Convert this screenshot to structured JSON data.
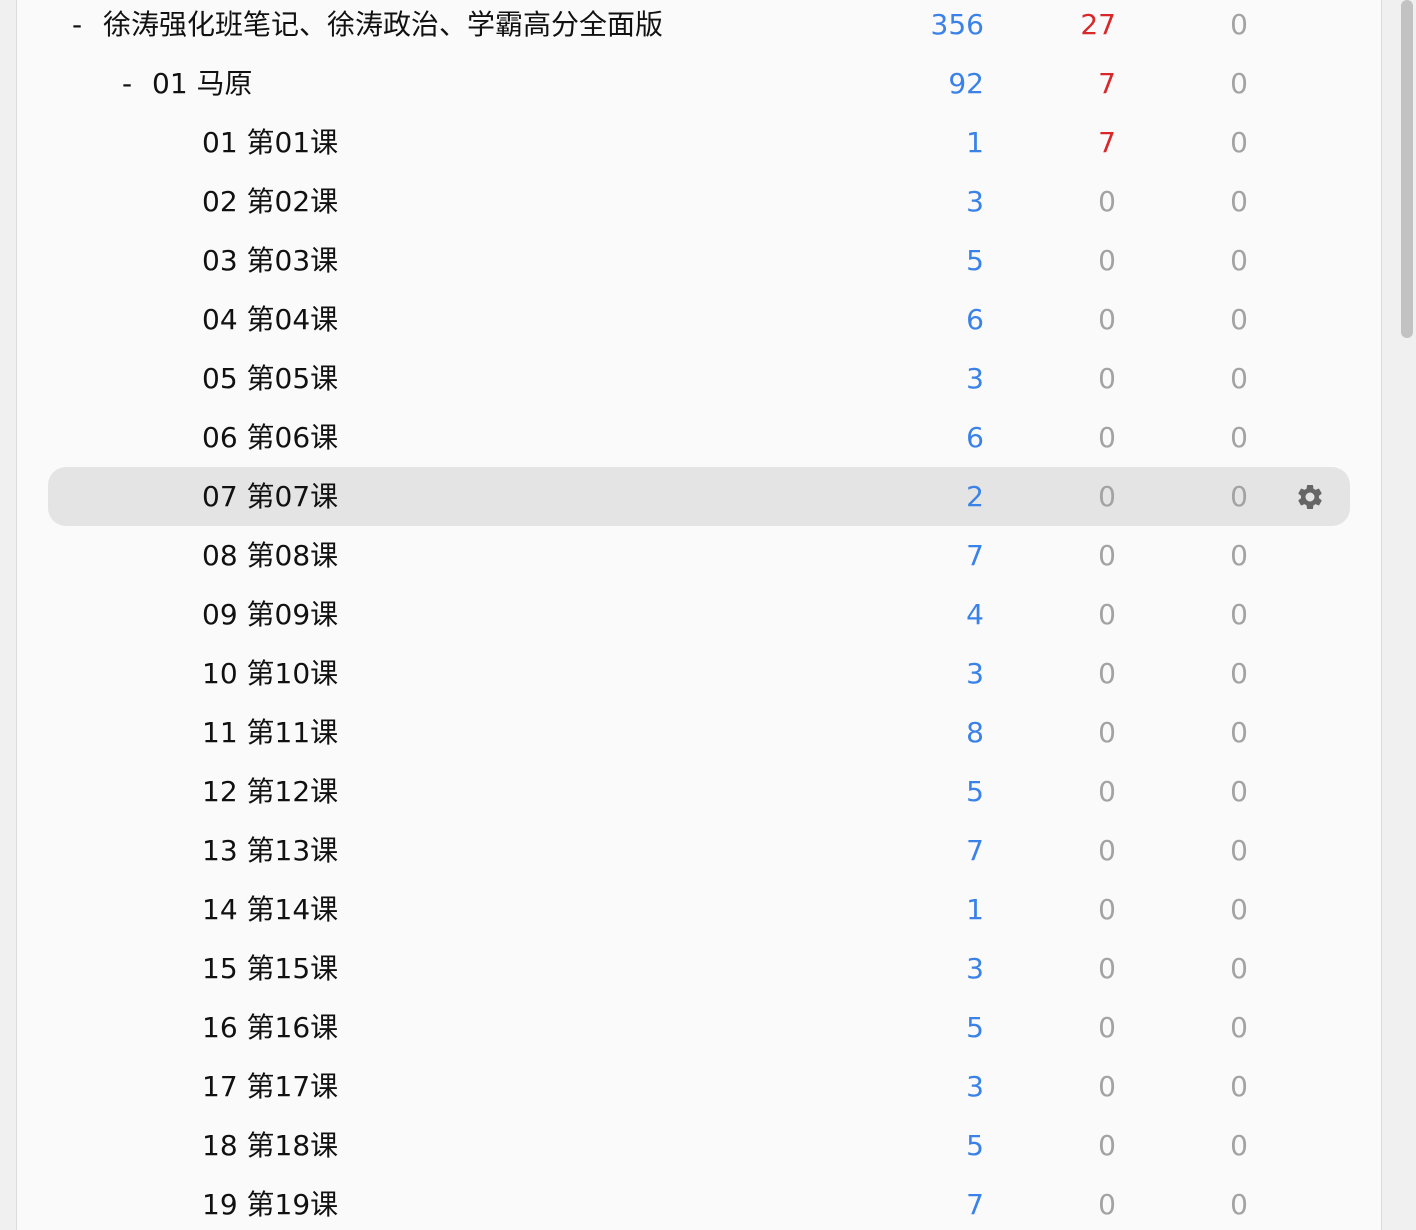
{
  "rows": [
    {
      "toggle": "-",
      "name": "徐涛强化班笔记、徐涛政治、学霸高分全面版",
      "level": 0,
      "n1": "356",
      "n2": "27",
      "n3": "0",
      "n1_color": "blue",
      "n2_color": "red"
    },
    {
      "toggle": "-",
      "name": "01 马原",
      "level": 1,
      "n1": "92",
      "n2": "7",
      "n3": "0",
      "n1_color": "blue",
      "n2_color": "red"
    },
    {
      "toggle": "",
      "name": "01 第01课",
      "level": 2,
      "n1": "1",
      "n2": "7",
      "n3": "0",
      "n1_color": "blue",
      "n2_color": "red"
    },
    {
      "toggle": "",
      "name": "02 第02课",
      "level": 2,
      "n1": "3",
      "n2": "0",
      "n3": "0",
      "n1_color": "blue",
      "n2_color": "gray"
    },
    {
      "toggle": "",
      "name": "03 第03课",
      "level": 2,
      "n1": "5",
      "n2": "0",
      "n3": "0",
      "n1_color": "blue",
      "n2_color": "gray"
    },
    {
      "toggle": "",
      "name": "04 第04课",
      "level": 2,
      "n1": "6",
      "n2": "0",
      "n3": "0",
      "n1_color": "blue",
      "n2_color": "gray"
    },
    {
      "toggle": "",
      "name": "05 第05课",
      "level": 2,
      "n1": "3",
      "n2": "0",
      "n3": "0",
      "n1_color": "blue",
      "n2_color": "gray"
    },
    {
      "toggle": "",
      "name": "06 第06课",
      "level": 2,
      "n1": "6",
      "n2": "0",
      "n3": "0",
      "n1_color": "blue",
      "n2_color": "gray"
    },
    {
      "toggle": "",
      "name": "07 第07课",
      "level": 2,
      "n1": "2",
      "n2": "0",
      "n3": "0",
      "n1_color": "blue",
      "n2_color": "gray",
      "selected": true
    },
    {
      "toggle": "",
      "name": "08 第08课",
      "level": 2,
      "n1": "7",
      "n2": "0",
      "n3": "0",
      "n1_color": "blue",
      "n2_color": "gray"
    },
    {
      "toggle": "",
      "name": "09 第09课",
      "level": 2,
      "n1": "4",
      "n2": "0",
      "n3": "0",
      "n1_color": "blue",
      "n2_color": "gray"
    },
    {
      "toggle": "",
      "name": "10 第10课",
      "level": 2,
      "n1": "3",
      "n2": "0",
      "n3": "0",
      "n1_color": "blue",
      "n2_color": "gray"
    },
    {
      "toggle": "",
      "name": "11 第11课",
      "level": 2,
      "n1": "8",
      "n2": "0",
      "n3": "0",
      "n1_color": "blue",
      "n2_color": "gray"
    },
    {
      "toggle": "",
      "name": "12 第12课",
      "level": 2,
      "n1": "5",
      "n2": "0",
      "n3": "0",
      "n1_color": "blue",
      "n2_color": "gray"
    },
    {
      "toggle": "",
      "name": "13 第13课",
      "level": 2,
      "n1": "7",
      "n2": "0",
      "n3": "0",
      "n1_color": "blue",
      "n2_color": "gray"
    },
    {
      "toggle": "",
      "name": "14 第14课",
      "level": 2,
      "n1": "1",
      "n2": "0",
      "n3": "0",
      "n1_color": "blue",
      "n2_color": "gray"
    },
    {
      "toggle": "",
      "name": "15 第15课",
      "level": 2,
      "n1": "3",
      "n2": "0",
      "n3": "0",
      "n1_color": "blue",
      "n2_color": "gray"
    },
    {
      "toggle": "",
      "name": "16 第16课",
      "level": 2,
      "n1": "5",
      "n2": "0",
      "n3": "0",
      "n1_color": "blue",
      "n2_color": "gray"
    },
    {
      "toggle": "",
      "name": "17 第17课",
      "level": 2,
      "n1": "3",
      "n2": "0",
      "n3": "0",
      "n1_color": "blue",
      "n2_color": "gray"
    },
    {
      "toggle": "",
      "name": "18 第18课",
      "level": 2,
      "n1": "5",
      "n2": "0",
      "n3": "0",
      "n1_color": "blue",
      "n2_color": "gray"
    },
    {
      "toggle": "",
      "name": "19 第19课",
      "level": 2,
      "n1": "7",
      "n2": "0",
      "n3": "0",
      "n1_color": "blue",
      "n2_color": "gray"
    }
  ],
  "colors": {
    "blue": "#3a82e8",
    "red": "#d8282a",
    "gray": "#a3a3a3"
  },
  "icons": {
    "options": "gear-icon"
  }
}
